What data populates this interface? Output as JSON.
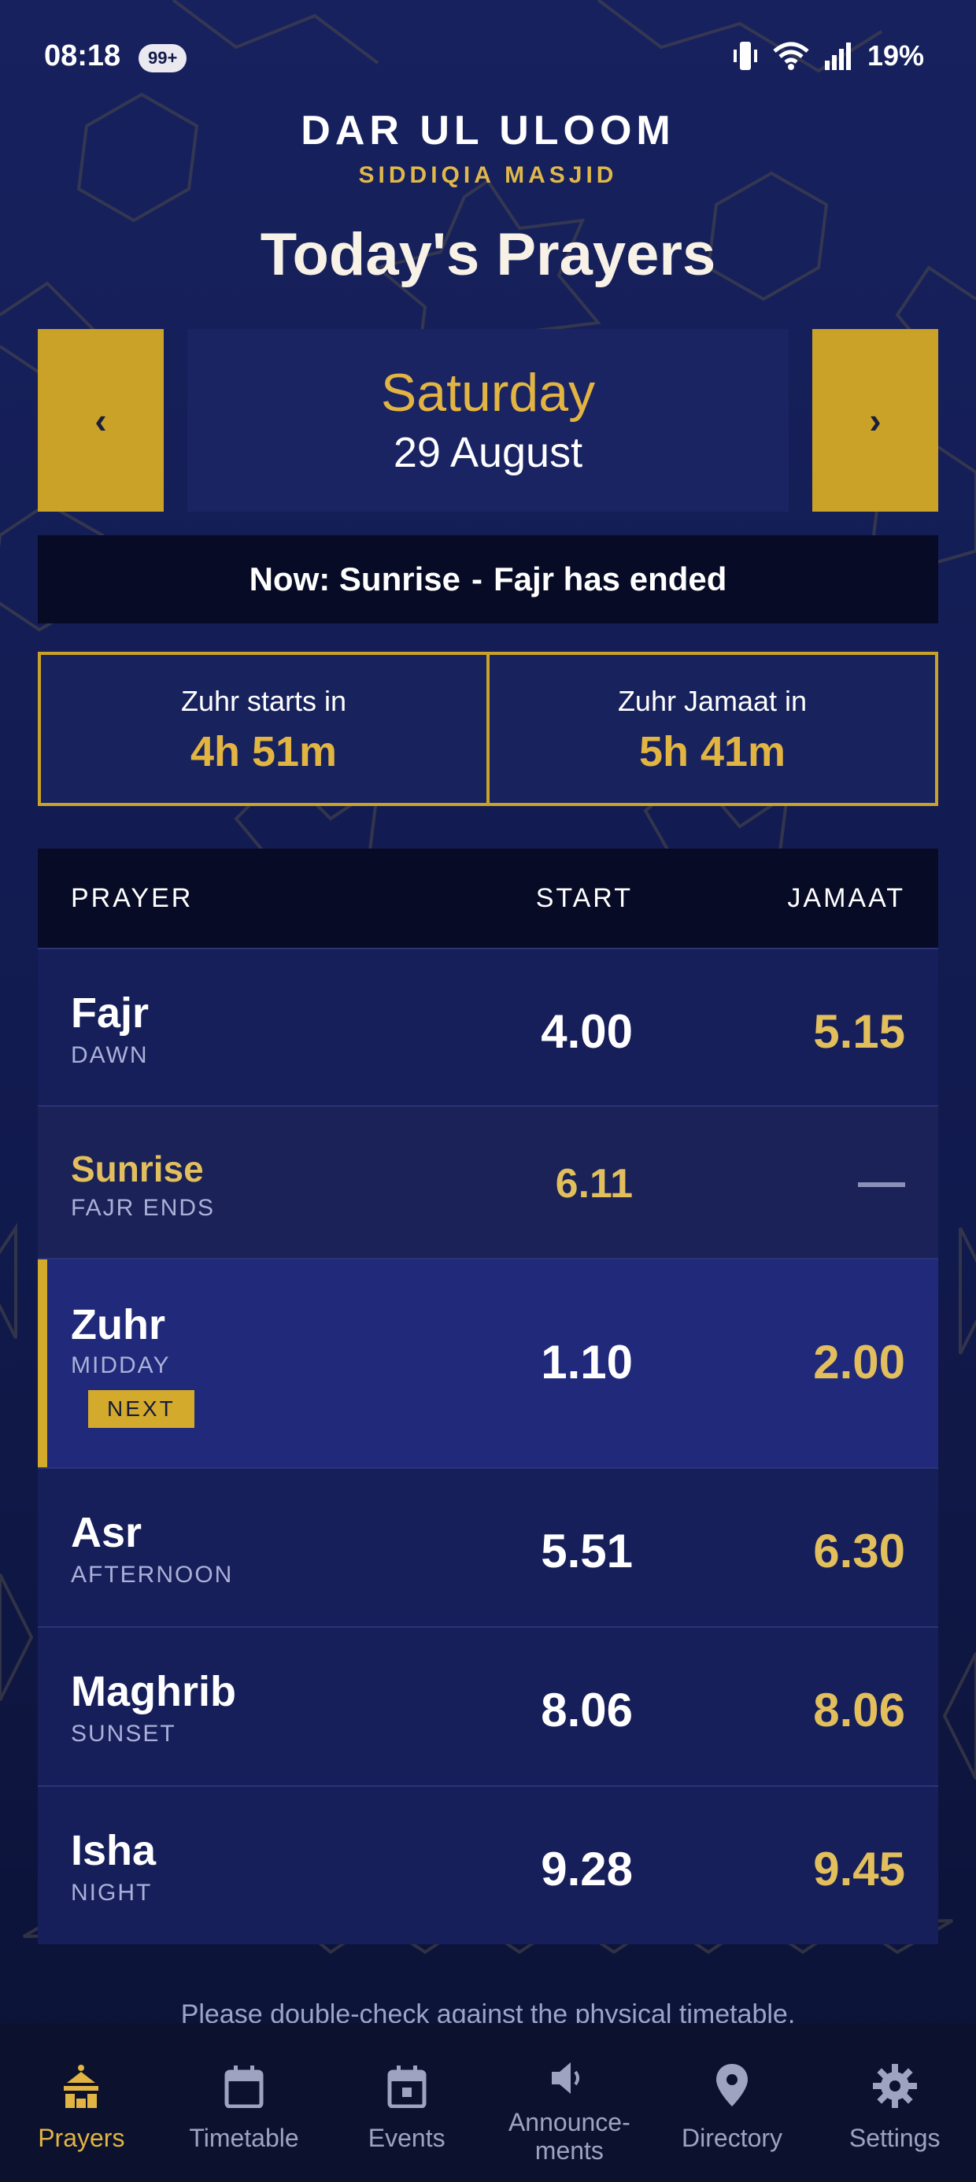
{
  "status_bar": {
    "time": "08:18",
    "notification_badge": "99+",
    "battery": "19%",
    "icons": [
      "vibrate-icon",
      "wifi-icon",
      "signal-icon"
    ]
  },
  "header": {
    "brand": "DAR UL ULOOM",
    "brand_sub": "SIDDIQIA MASJID",
    "title": "Today's Prayers"
  },
  "day_selector": {
    "prev_label": "‹",
    "next_label": "›",
    "day": "Saturday",
    "date": "29 August"
  },
  "now_banner": {
    "now": "Now: Sunrise",
    "separator": "-",
    "detail": "Fajr has ended"
  },
  "countdowns": [
    {
      "label": "Zuhr starts in",
      "value": "4h 51m"
    },
    {
      "label": "Zuhr Jamaat in",
      "value": "5h 41m"
    }
  ],
  "table": {
    "headers": {
      "prayer": "PRAYER",
      "start": "START",
      "jamaat": "JAMAAT"
    },
    "rows": [
      {
        "name": "Fajr",
        "sub": "DAWN",
        "start": "4.00",
        "jamaat": "5.15"
      },
      {
        "name": "Sunrise",
        "sub": "FAJR ENDS",
        "start": "6.11",
        "jamaat": ""
      },
      {
        "name": "Zuhr",
        "sub": "MIDDAY",
        "start": "1.10",
        "jamaat": "2.00",
        "badge": "NEXT"
      },
      {
        "name": "Asr",
        "sub": "AFTERNOON",
        "start": "5.51",
        "jamaat": "6.30"
      },
      {
        "name": "Maghrib",
        "sub": "SUNSET",
        "start": "8.06",
        "jamaat": "8.06"
      },
      {
        "name": "Isha",
        "sub": "NIGHT",
        "start": "9.28",
        "jamaat": "9.45"
      }
    ]
  },
  "disclaimer": "Please double-check against the physical timetable.",
  "bottom_nav": [
    {
      "label": "Prayers",
      "icon": "mosque-icon",
      "active": true
    },
    {
      "label": "Timetable",
      "icon": "calendar-icon",
      "active": false
    },
    {
      "label": "Events",
      "icon": "event-icon",
      "active": false
    },
    {
      "label": "Announce-\nments",
      "icon": "speaker-icon",
      "active": false
    },
    {
      "label": "Directory",
      "icon": "location-pin-icon",
      "active": false
    },
    {
      "label": "Settings",
      "icon": "gear-icon",
      "active": false
    }
  ],
  "colors": {
    "background": "#17215e",
    "accent_gold": "#c9a227",
    "gold_text": "#e2b442",
    "dark_banner": "#070b26"
  }
}
